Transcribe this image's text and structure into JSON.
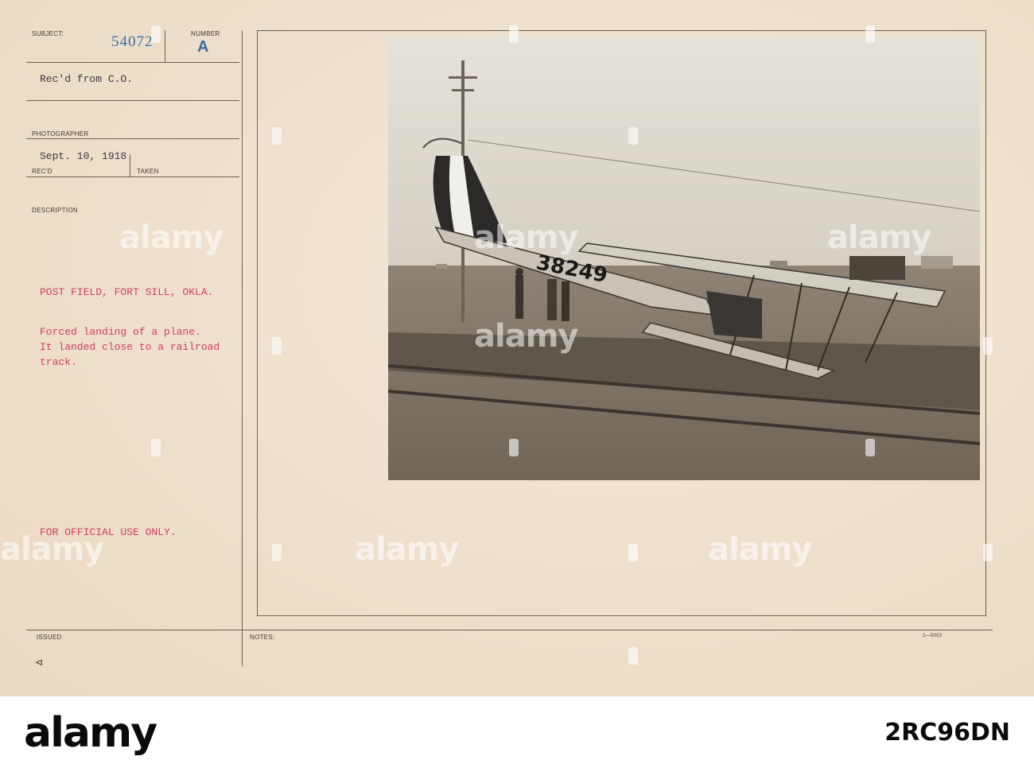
{
  "card": {
    "labels": {
      "subject": "SUBJECT:",
      "number": "NUMBER",
      "photographer": "PHOTOGRAPHER",
      "recd": "REC'D",
      "taken": "TAKEN",
      "description": "DESCRIPTION",
      "issued": "ISSUED",
      "notes": "NOTES:"
    },
    "subject_number": "54072",
    "number_letter": "A",
    "received_from": "Rec'd from C.O.",
    "date": "Sept. 10, 1918",
    "location": "POST FIELD, FORT SILL, OKLA.",
    "description_text": "Forced landing of a plane.\nIt landed close to a railroad\ntrack.",
    "official_use": "FOR OFFICIAL USE ONLY.",
    "form_code": "2—5002"
  },
  "photo": {
    "aircraft_number": "38249"
  },
  "watermark": {
    "text": "alamy"
  },
  "footer": {
    "brand": "alamy",
    "image_id": "2RC96DN"
  }
}
